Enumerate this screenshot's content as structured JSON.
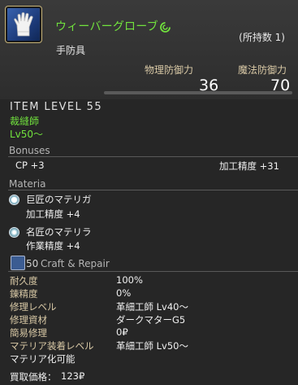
{
  "item": {
    "name": "ウィーバーグローブ",
    "owned": "(所持数 1)",
    "category": "手防具",
    "icon": "glove-icon"
  },
  "stats": {
    "physical_label": "物理防御力",
    "physical_value": "36",
    "magic_label": "魔法防御力",
    "magic_value": "70"
  },
  "item_level": "ITEM LEVEL 55",
  "class_job": "裁縫師",
  "level_req": "Lv50〜",
  "bonuses": {
    "title": "Bonuses",
    "left": "CP +3",
    "right": "加工精度 +31"
  },
  "materia": {
    "title": "Materia",
    "slots": [
      {
        "name": "巨匠のマテリガ",
        "effect": "加工精度 +4"
      },
      {
        "name": "名匠のマテリラ",
        "effect": "作業精度 +4"
      }
    ]
  },
  "craft": {
    "level": "50",
    "title": "Craft & Repair",
    "rows": [
      {
        "label": "耐久度",
        "value": "100%"
      },
      {
        "label": "錬精度",
        "value": "0%"
      },
      {
        "label": "修理レベル",
        "value": "革細工師 Lv40〜"
      },
      {
        "label": "修理資材",
        "value": "ダークマターG5"
      },
      {
        "label": "簡易修理",
        "value": "0₽"
      },
      {
        "label": "マテリア装着レベル",
        "value": "革細工師 Lv50〜"
      }
    ],
    "melding": "マテリア化可能",
    "price_label": "買取価格：",
    "price_value": "123₽"
  },
  "colors": {
    "item_name": "#71e23d",
    "label": "#d9c9a6",
    "section": "#b4b4b4"
  }
}
